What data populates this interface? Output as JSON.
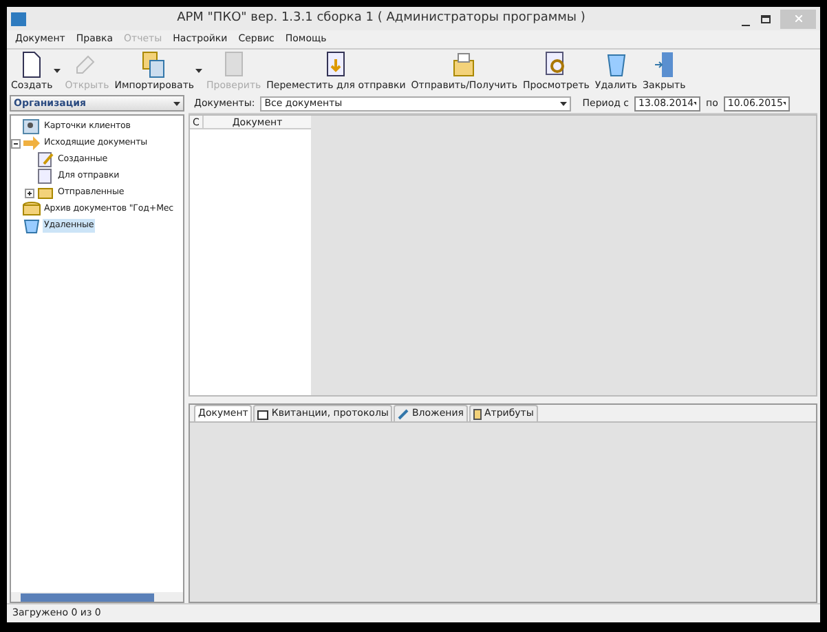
{
  "window": {
    "title": "АРМ \"ПКО\" вер. 1.3.1 сборка 1 ( Администраторы программы )"
  },
  "menu": [
    {
      "label": "Документ",
      "disabled": false
    },
    {
      "label": "Правка",
      "disabled": false
    },
    {
      "label": "Отчеты",
      "disabled": true
    },
    {
      "label": "Настройки",
      "disabled": false
    },
    {
      "label": "Сервис",
      "disabled": false
    },
    {
      "label": "Помощь",
      "disabled": false
    }
  ],
  "toolbar": [
    {
      "label": "Создать",
      "kind": "new",
      "disabled": false,
      "dropdown": true
    },
    {
      "label": "Открыть",
      "kind": "open",
      "disabled": true,
      "dropdown": false
    },
    {
      "label": "Импортировать",
      "kind": "import",
      "disabled": false,
      "dropdown": true
    },
    {
      "label": "Проверить",
      "kind": "check",
      "disabled": true,
      "dropdown": false
    },
    {
      "label": "Переместить для отправки",
      "kind": "move",
      "disabled": false,
      "dropdown": false
    },
    {
      "label": "Отправить/Получить",
      "kind": "send",
      "disabled": false,
      "dropdown": false
    },
    {
      "label": "Просмотреть",
      "kind": "view",
      "disabled": false,
      "dropdown": false
    },
    {
      "label": "Удалить",
      "kind": "delete",
      "disabled": false,
      "dropdown": false
    },
    {
      "label": "Закрыть",
      "kind": "close",
      "disabled": false,
      "dropdown": false
    }
  ],
  "organization_select": {
    "value": "Организация"
  },
  "tree": [
    {
      "label": "Карточки клиентов",
      "kind": "cards",
      "selected": false
    },
    {
      "label": "Исходящие документы",
      "kind": "outgoing",
      "selected": false,
      "expanded": true,
      "children": [
        {
          "label": "Созданные",
          "kind": "created",
          "selected": false
        },
        {
          "label": "Для отправки",
          "kind": "tosend",
          "selected": false
        },
        {
          "label": "Отправленные",
          "kind": "sent",
          "selected": false,
          "expanded": false
        }
      ]
    },
    {
      "label": "Архив документов \"Год+Мес",
      "kind": "archive",
      "selected": false
    },
    {
      "label": "Удаленные",
      "kind": "deleted",
      "selected": true
    }
  ],
  "filter": {
    "documents_label": "Документы:",
    "documents_value": "Все документы",
    "period_label": "Период с",
    "date_from": "13.08.2014",
    "to_label": "по",
    "date_to": "10.06.2015"
  },
  "table": {
    "columns": [
      "С",
      "Документ"
    ]
  },
  "tabs": [
    {
      "label": "Документ",
      "kind": "plain",
      "selected": true
    },
    {
      "label": "Квитанции, протоколы",
      "kind": "receipt",
      "selected": false
    },
    {
      "label": "Вложения",
      "kind": "attach",
      "selected": false
    },
    {
      "label": "Атрибуты",
      "kind": "attr",
      "selected": false
    }
  ],
  "status_bar": "Загружено 0 из 0"
}
